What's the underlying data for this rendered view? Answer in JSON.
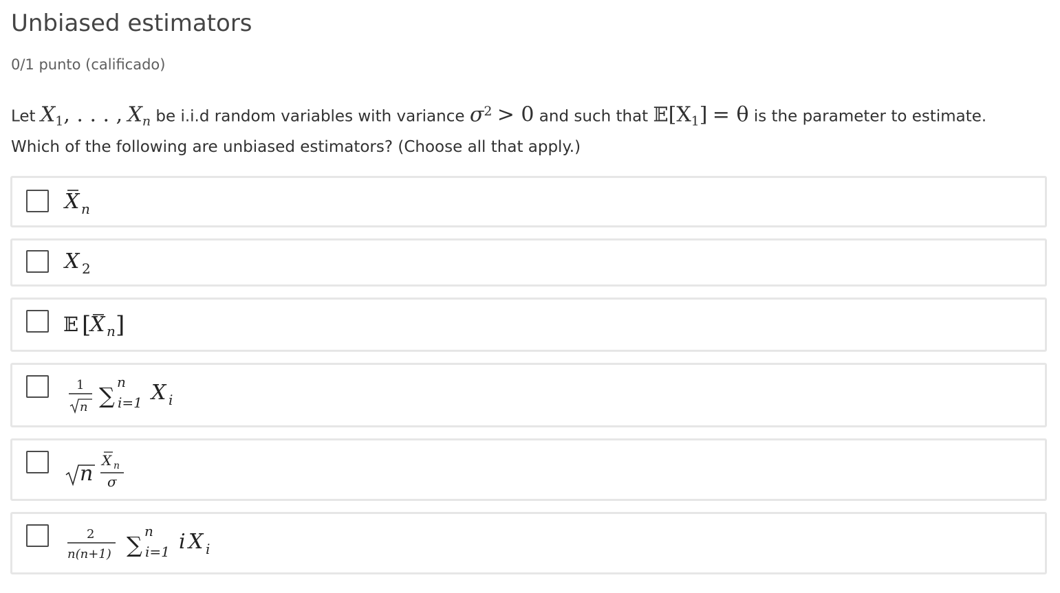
{
  "problem": {
    "title": "Unbiased estimators",
    "grade": "0/1 punto (calificado)",
    "question": {
      "let": "Let",
      "x1": "X",
      "x1_sub": "1",
      "dots": ", . . . ,",
      "xn": "X",
      "xn_sub": "n",
      "be_iid": "be i.i.d random variables with variance",
      "sigma": "σ",
      "sigma_sup": "2",
      "gt_zero": "> 0",
      "such_that": "and such that",
      "expect_symbol": "𝔼",
      "expect_arg": "[X",
      "expect_sub": "1",
      "expect_close": "]",
      "eq_theta": "= θ",
      "is_param": "is the parameter to estimate.",
      "line2": "Which of the following are unbiased estimators? (Choose all that apply.)"
    },
    "options": [
      {
        "id": "a",
        "latex": "\\bar{X}_n",
        "checked": false
      },
      {
        "id": "b",
        "latex": "X_2",
        "checked": false
      },
      {
        "id": "c",
        "latex": "\\mathbb{E}[\\bar{X}_n]",
        "checked": false
      },
      {
        "id": "d",
        "latex": "\\frac{1}{\\sqrt{n}}\\sum_{i=1}^n X_i",
        "checked": false
      },
      {
        "id": "e",
        "latex": "\\sqrt{n}\\frac{\\bar{X}_n}{\\sigma}",
        "checked": false
      },
      {
        "id": "f",
        "latex": "\\frac{2}{n(n+1)}\\sum_{i=1}^n iX_i",
        "checked": false
      }
    ],
    "glyphs": {
      "X": "X",
      "n": "n",
      "i": "i",
      "two": "2",
      "one": "1",
      "sigma": "σ",
      "sum": "∑",
      "i_eq_1": "i=1",
      "E": "𝔼",
      "lbracket": "[",
      "rbracket": "]",
      "n_paren": "n(n+1)",
      "macron": "¯"
    }
  }
}
